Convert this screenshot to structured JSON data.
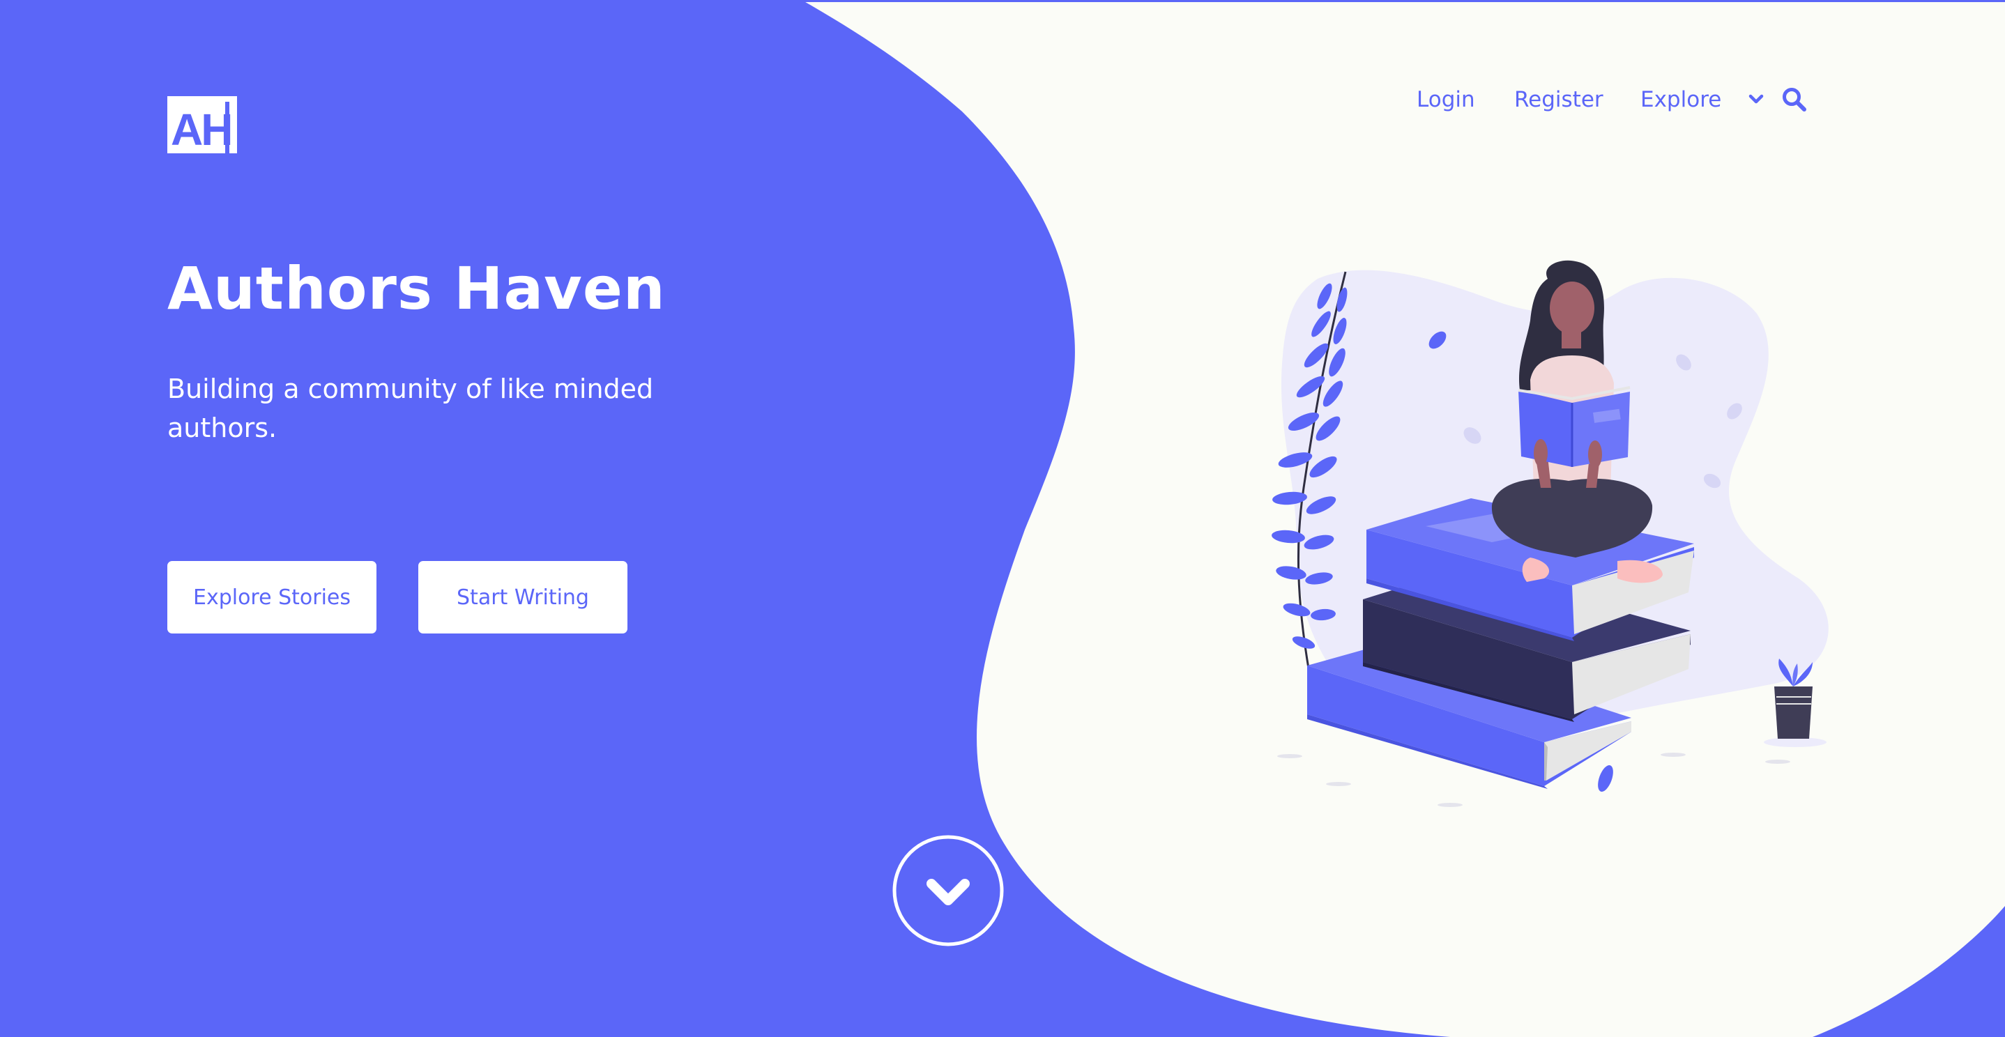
{
  "app": {
    "logo_text": "AH",
    "title": "Authors Haven",
    "subtitle": "Building a community of like minded authors."
  },
  "nav": {
    "login": "Login",
    "register": "Register",
    "explore": "Explore",
    "explore_icon": "chevron-down-icon",
    "search_icon": "search-icon"
  },
  "buttons": {
    "explore_stories": "Explore Stories",
    "start_writing": "Start Writing"
  },
  "scroll": {
    "icon": "chevron-down-circle-icon"
  },
  "colors": {
    "brand": "#5b66f8",
    "background": "#fbfcf7",
    "dark_book": "#2f2e59",
    "accent_light": "#ecebfb"
  }
}
